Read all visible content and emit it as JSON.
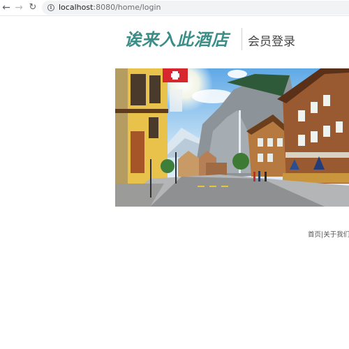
{
  "browser": {
    "url_host": "localhost",
    "url_path": ":8080/home/login"
  },
  "header": {
    "brand": "诶来入此酒店",
    "title": "会员登录"
  },
  "footer": {
    "links": [
      "首页",
      "关于我们"
    ],
    "separator": "|"
  },
  "icons": [
    "back-arrow-icon",
    "forward-arrow-icon",
    "reload-icon",
    "info-icon"
  ],
  "colors": {
    "brand": "#3b8e87",
    "sky": "#8ec6ef"
  }
}
